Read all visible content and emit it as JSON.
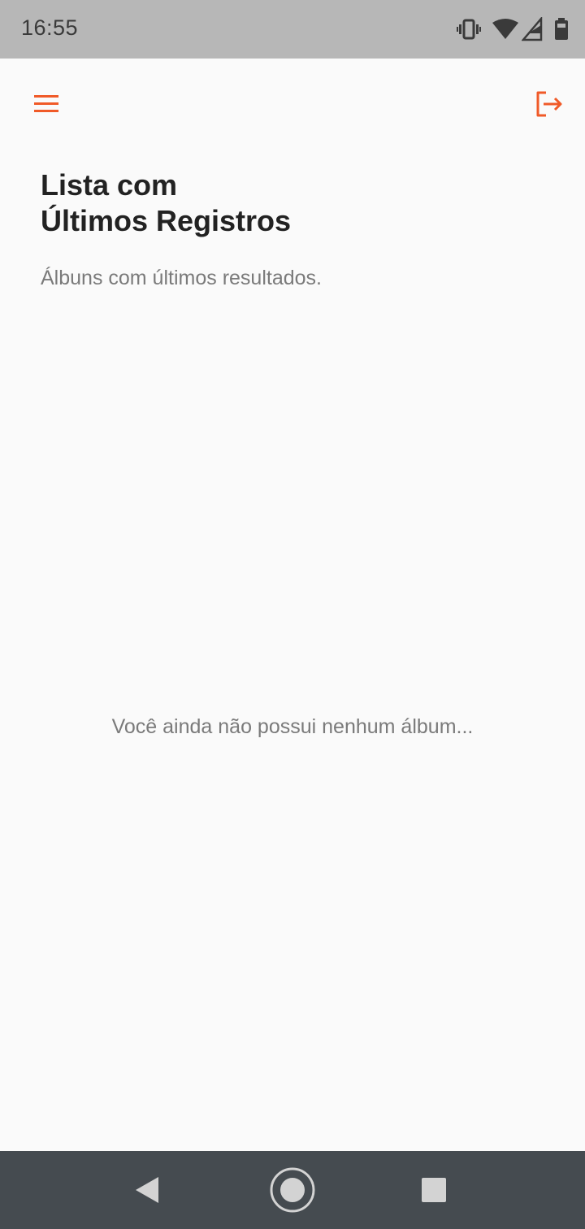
{
  "status_bar": {
    "time": "16:55",
    "icons": [
      "vibrate-icon",
      "wifi-icon",
      "signal-icon",
      "battery-icon"
    ]
  },
  "app_bar": {
    "menu_icon": "hamburger-menu-icon",
    "logout_icon": "logout-icon",
    "accent_color": "#f05a28"
  },
  "main": {
    "title_line1": "Lista com",
    "title_line2": "Últimos Registros",
    "subtitle": "Álbuns com últimos resultados.",
    "empty_message": "Você ainda não possui nenhum álbum..."
  },
  "nav_bar": {
    "buttons": [
      "back-icon",
      "home-icon",
      "recents-icon"
    ]
  }
}
